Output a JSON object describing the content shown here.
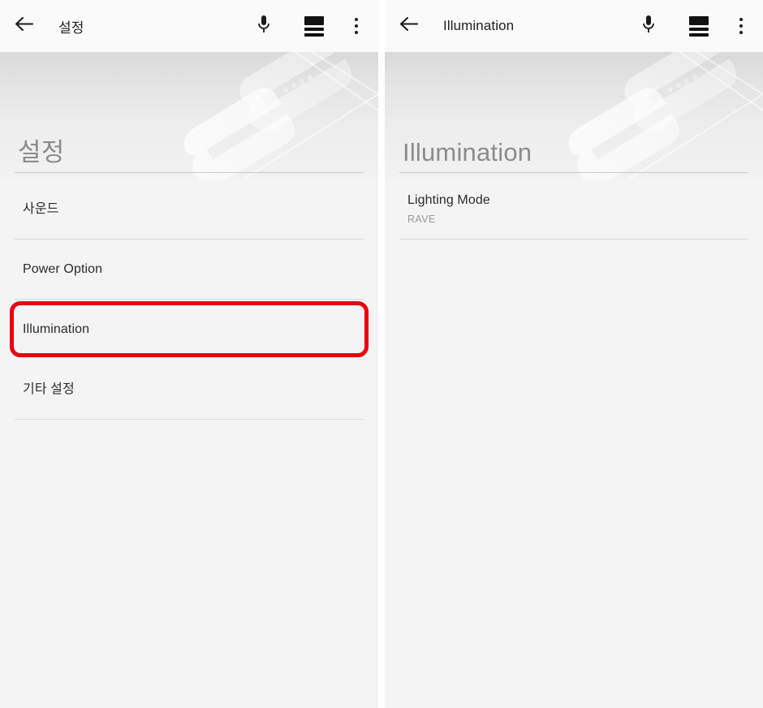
{
  "theme": {
    "accent_red": "#ea0011",
    "toolbar_bg": "#fafafa",
    "page_bg": "#f4f4f4",
    "title_gray": "#8c8c8c",
    "divider": "#dcdcdc"
  },
  "panels": [
    {
      "toolbar": {
        "back_icon": "arrow-back-icon",
        "title": "설정",
        "mic_icon": "microphone-icon",
        "stack_icon": "stacked-bars-icon",
        "overflow_icon": "more-vertical-icon"
      },
      "hero": {
        "title": "설정",
        "art": "wrench-tools-watermark"
      },
      "list": [
        {
          "title": "사운드",
          "sub": "",
          "highlighted": false
        },
        {
          "title": "Power Option",
          "sub": "",
          "highlighted": false
        },
        {
          "title": "Illumination",
          "sub": "",
          "highlighted": true
        },
        {
          "title": "기타 설정",
          "sub": "",
          "highlighted": false
        }
      ]
    },
    {
      "toolbar": {
        "back_icon": "arrow-back-icon",
        "title": "Illumination",
        "mic_icon": "microphone-icon",
        "stack_icon": "stacked-bars-icon",
        "overflow_icon": "more-vertical-icon"
      },
      "hero": {
        "title": "Illumination",
        "art": "wrench-tools-watermark"
      },
      "list": [
        {
          "title": "Lighting Mode",
          "sub": "RAVE",
          "highlighted": false
        }
      ]
    }
  ]
}
